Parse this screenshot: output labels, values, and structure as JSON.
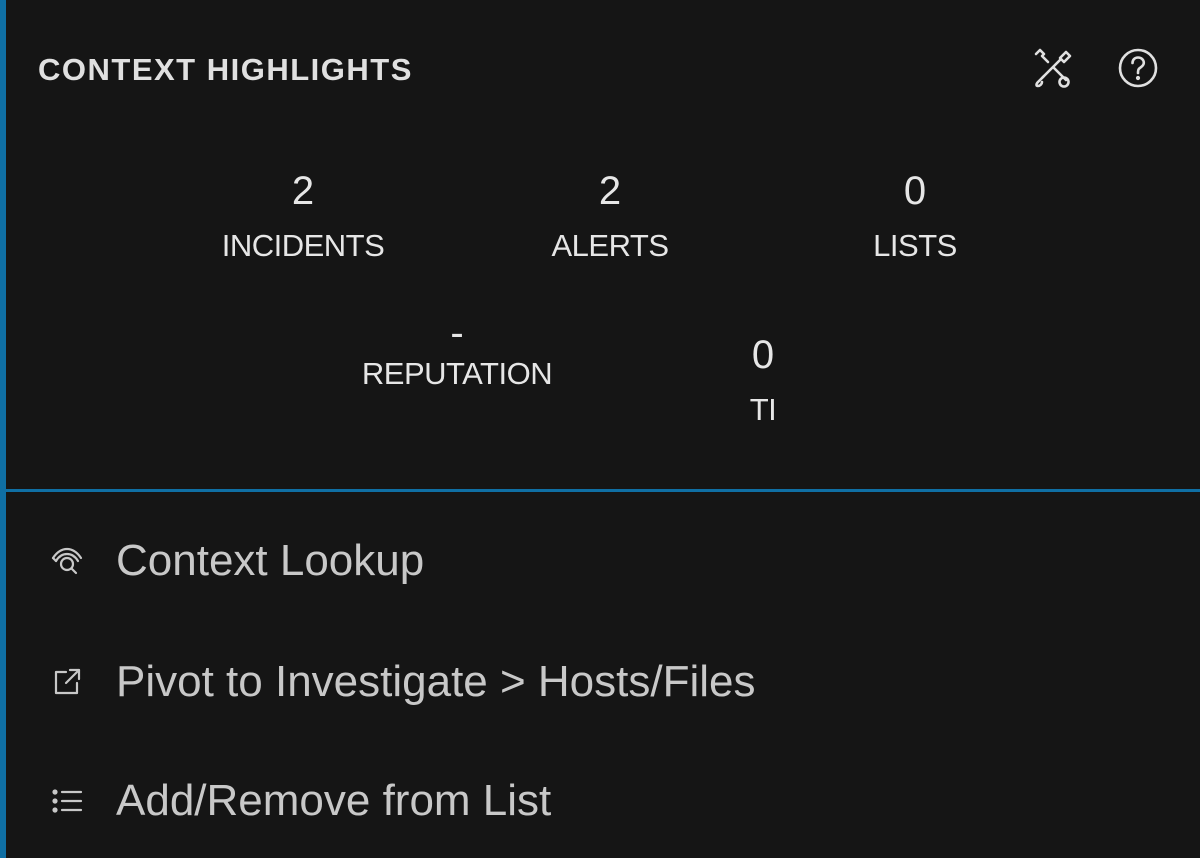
{
  "header": {
    "title": "CONTEXT HIGHLIGHTS",
    "tools_icon": "tools-icon",
    "help_icon": "help-icon"
  },
  "stats": {
    "incidents": {
      "value": "2",
      "label": "INCIDENTS"
    },
    "alerts": {
      "value": "2",
      "label": "ALERTS"
    },
    "lists": {
      "value": "0",
      "label": "LISTS"
    },
    "reputation": {
      "value": "-",
      "label": "REPUTATION"
    },
    "ti": {
      "value": "0",
      "label": "TI"
    }
  },
  "actions": {
    "lookup": {
      "label": "Context Lookup",
      "icon": "eye-search-icon"
    },
    "pivot": {
      "label": "Pivot to Investigate > Hosts/Files",
      "icon": "external-link-icon"
    },
    "list": {
      "label": "Add/Remove from List",
      "icon": "list-icon"
    }
  },
  "colors": {
    "background": "#151515",
    "accent": "#0f6fa4",
    "text": "#e6e6e6",
    "muted_text": "#c8c8c8"
  }
}
